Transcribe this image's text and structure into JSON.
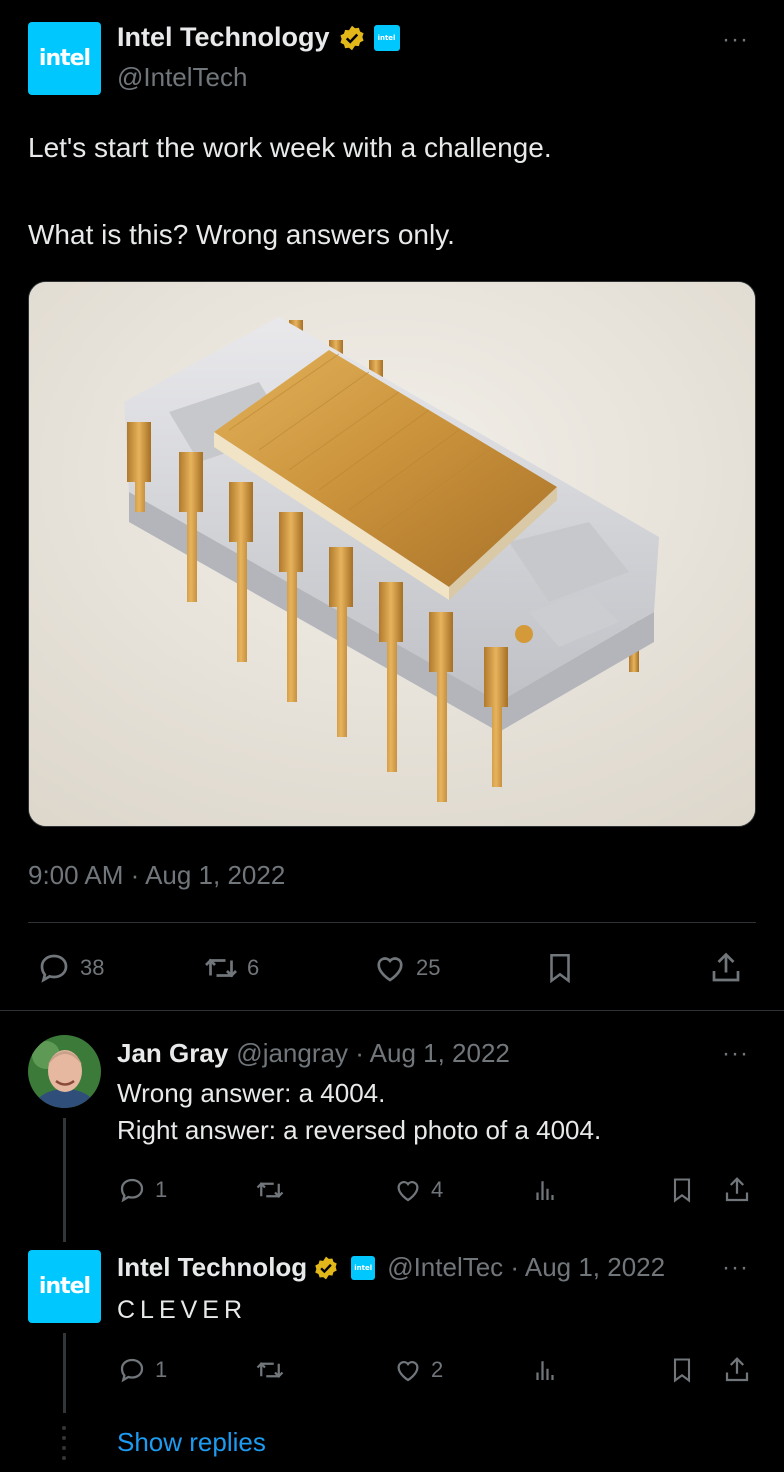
{
  "tweet": {
    "author_name": "Intel Technology",
    "handle": "@IntelTech",
    "logo_text": "intel",
    "badge_text": "intel",
    "text_line1": "Let's start the work week with a challenge.",
    "text_line2": "What is this? Wrong answers only.",
    "image_icon": "intel-4004-chip-photo",
    "timestamp": "9:00 AM · Aug 1, 2022",
    "replies": "38",
    "retweets": "6",
    "likes": "25"
  },
  "replies": [
    {
      "author_name": "Jan Gray",
      "meta": "@jangray · Aug 1, 2022",
      "line1": "Wrong answer: a 4004.",
      "line2": "Right answer: a reversed photo of a 4004.",
      "reply_count": "1",
      "like_count": "4"
    },
    {
      "author_name": "Intel Technolog",
      "meta": "@IntelTec · Aug 1, 2022",
      "line1": "CLEVER",
      "reply_count": "1",
      "like_count": "2"
    }
  ],
  "show_replies": "Show replies",
  "more_label": "···",
  "colors": {
    "accent": "#1d9bf0",
    "verified": "#e2b719",
    "intel_blue": "#00c7fd"
  }
}
